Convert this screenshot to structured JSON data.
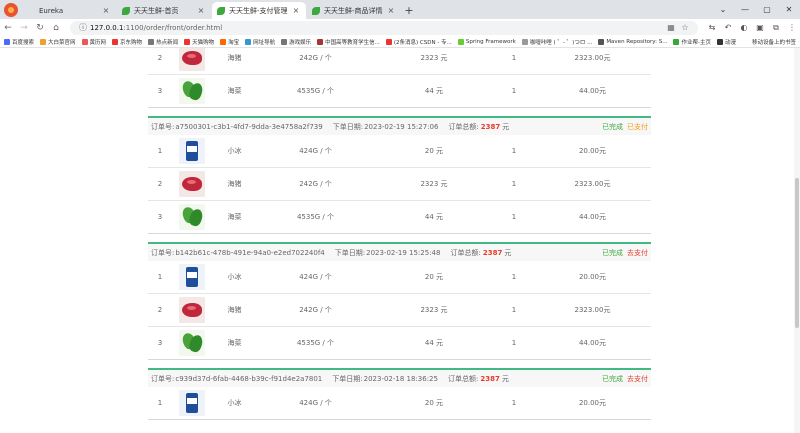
{
  "browser": {
    "tabs": [
      {
        "title": "Eureka",
        "icon": "blank",
        "active": false
      },
      {
        "title": "天天生鲜-首页",
        "icon": "leaf",
        "active": false
      },
      {
        "title": "天天生鲜-支付管理",
        "icon": "leaf",
        "active": true
      },
      {
        "title": "天天生鲜-商品详情",
        "icon": "leaf",
        "active": false
      }
    ],
    "new_tab": "+",
    "url_host": "127.0.0.1",
    "url_path": ":1100/order/front/order.html",
    "bookmarks": [
      "百度搜索",
      "大白菜官网",
      "黄历网",
      "京东购物",
      "热点新闻",
      "天猫购物",
      "淘宝",
      "网址导航",
      "游戏娱乐",
      "中国高等教育学生信...",
      "(2条消息) CSDN - 专...",
      "Spring Framework",
      "咖喱咔哩 ( ゜- ゜)つロ ...",
      "Maven Repository: S...",
      "作业帮-主页",
      "动漫"
    ],
    "bookmarks_right": "移动设备上的书签"
  },
  "labels": {
    "order_no": "订单号:",
    "order_date": "下单日期:",
    "order_total": "订单总额:",
    "currency": "元",
    "status_done": "已完成",
    "status_paid": "已支付",
    "status_topay": "去支付"
  },
  "partial_rows": [
    {
      "idx": "2",
      "img": "meat",
      "name": "海猪",
      "spec": "242G / 个",
      "price": "2323 元",
      "qty": "1",
      "subtotal": "2323.00元"
    },
    {
      "idx": "3",
      "img": "veg",
      "name": "海菜",
      "spec": "4535G / 个",
      "price": "44 元",
      "qty": "1",
      "subtotal": "44.00元"
    }
  ],
  "orders": [
    {
      "id": "a7500301-c3b1-4fd7-9dda-3e4758a2f739",
      "date": "2023-02-19 15:27:06",
      "total": "2387",
      "status1": "已完成",
      "status2": "已支付",
      "items": [
        {
          "idx": "1",
          "img": "ice",
          "name": "小冰",
          "spec": "424G / 个",
          "price": "20 元",
          "qty": "1",
          "subtotal": "20.00元"
        },
        {
          "idx": "2",
          "img": "meat",
          "name": "海猪",
          "spec": "242G / 个",
          "price": "2323 元",
          "qty": "1",
          "subtotal": "2323.00元"
        },
        {
          "idx": "3",
          "img": "veg",
          "name": "海菜",
          "spec": "4535G / 个",
          "price": "44 元",
          "qty": "1",
          "subtotal": "44.00元"
        }
      ]
    },
    {
      "id": "b142b61c-478b-491e-94a0-e2ed702240f4",
      "date": "2023-02-19 15:25:48",
      "total": "2387",
      "status1": "已完成",
      "status2": "去支付",
      "items": [
        {
          "idx": "1",
          "img": "ice",
          "name": "小冰",
          "spec": "424G / 个",
          "price": "20 元",
          "qty": "1",
          "subtotal": "20.00元"
        },
        {
          "idx": "2",
          "img": "meat",
          "name": "海猪",
          "spec": "242G / 个",
          "price": "2323 元",
          "qty": "1",
          "subtotal": "2323.00元"
        },
        {
          "idx": "3",
          "img": "veg",
          "name": "海菜",
          "spec": "4535G / 个",
          "price": "44 元",
          "qty": "1",
          "subtotal": "44.00元"
        }
      ]
    },
    {
      "id": "c939d37d-6fab-4468-b39c-f91d4e2a7801",
      "date": "2023-02-18 18:36:25",
      "total": "2387",
      "status1": "已完成",
      "status2": "去支付",
      "items": [
        {
          "idx": "1",
          "img": "ice",
          "name": "小冰",
          "spec": "424G / 个",
          "price": "20 元",
          "qty": "1",
          "subtotal": "20.00元"
        }
      ]
    }
  ]
}
